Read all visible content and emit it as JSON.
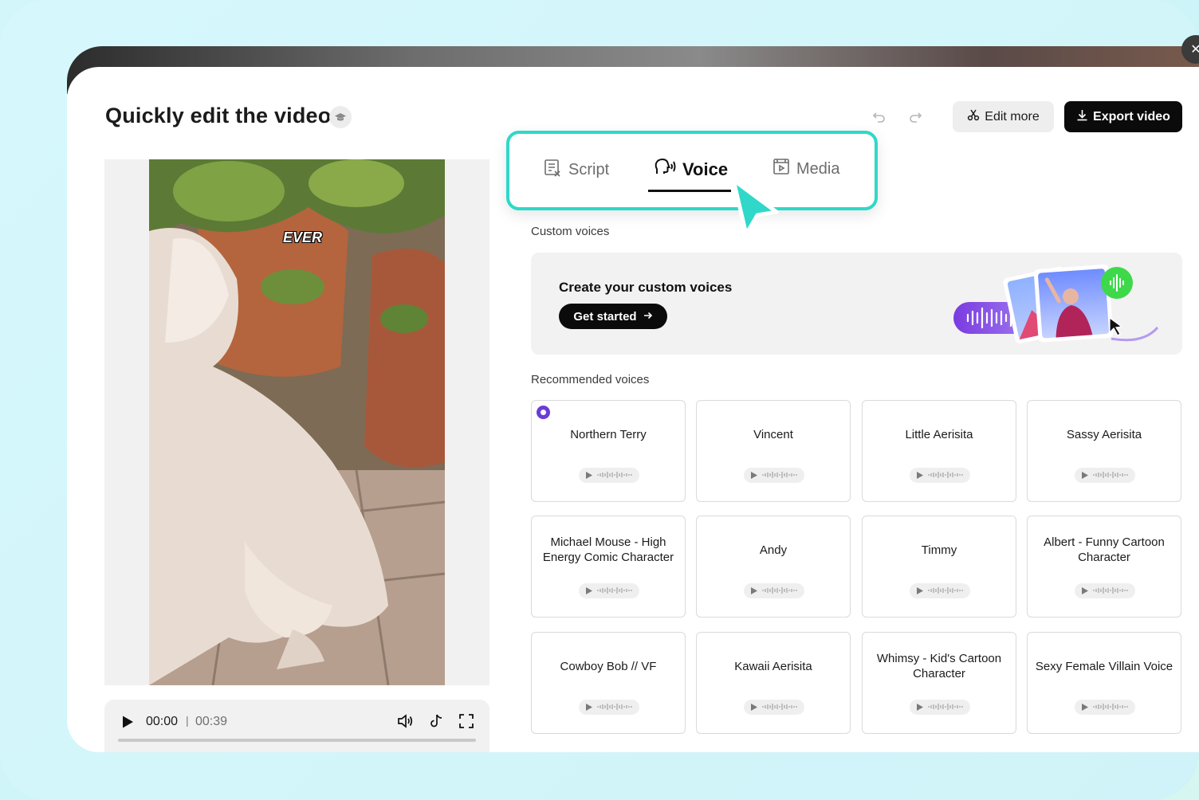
{
  "header": {
    "title": "Quickly edit the video",
    "edit_more_label": "Edit more",
    "export_label": "Export video"
  },
  "video": {
    "caption": "EVER",
    "current_time": "00:00",
    "separator": "|",
    "total_time": "00:39"
  },
  "tabs": [
    {
      "label": "Script",
      "icon": "script-icon",
      "active": false
    },
    {
      "label": "Voice",
      "icon": "voice-icon",
      "active": true
    },
    {
      "label": "Media",
      "icon": "media-icon",
      "active": false
    }
  ],
  "custom_voices": {
    "section_label": "Custom voices",
    "card_title": "Create your custom voices",
    "button_label": "Get started"
  },
  "recommended": {
    "section_label": "Recommended voices",
    "voices": [
      {
        "name": "Northern Terry",
        "selected": true
      },
      {
        "name": "Vincent",
        "selected": false
      },
      {
        "name": "Little Aerisita",
        "selected": false
      },
      {
        "name": "Sassy Aerisita",
        "selected": false
      },
      {
        "name": "Michael Mouse - High Energy Comic Character",
        "selected": false
      },
      {
        "name": "Andy",
        "selected": false
      },
      {
        "name": "Timmy",
        "selected": false
      },
      {
        "name": "Albert - Funny Cartoon Character",
        "selected": false
      },
      {
        "name": "Cowboy Bob // VF",
        "selected": false
      },
      {
        "name": "Kawaii Aerisita",
        "selected": false
      },
      {
        "name": "Whimsy - Kid's Cartoon Character",
        "selected": false
      },
      {
        "name": "Sexy Female Villain Voice",
        "selected": false
      }
    ]
  },
  "colors": {
    "accent_teal": "#2fd8c8",
    "accent_purple": "#6a3cd8",
    "accent_green": "#3dd94a",
    "button_dark": "#0b0b0b"
  }
}
